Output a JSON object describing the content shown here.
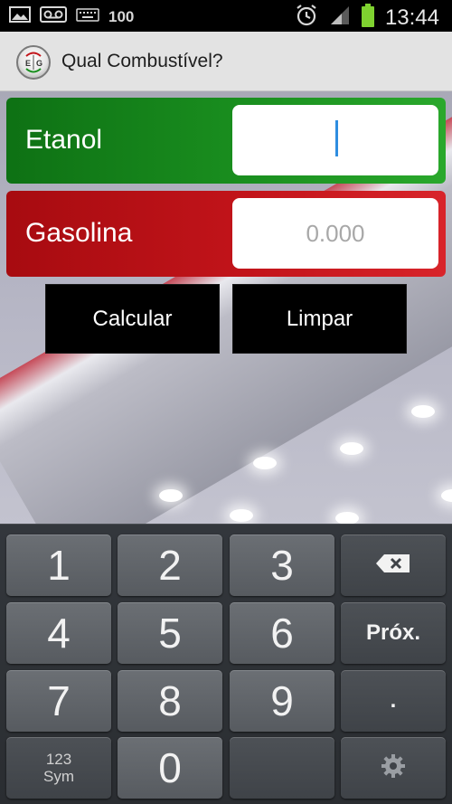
{
  "status_bar": {
    "notification_count": "100",
    "time": "13:44"
  },
  "app_bar": {
    "title": "Qual Combustível?",
    "logo_letters": "E G"
  },
  "form": {
    "etanol": {
      "label": "Etanol",
      "value": "",
      "placeholder": ""
    },
    "gasolina": {
      "label": "Gasolina",
      "value": "",
      "placeholder": "0.000"
    }
  },
  "buttons": {
    "calcular": "Calcular",
    "limpar": "Limpar"
  },
  "keyboard": {
    "rows": [
      [
        "1",
        "2",
        "3",
        "backspace"
      ],
      [
        "4",
        "5",
        "6",
        "Próx."
      ],
      [
        "7",
        "8",
        "9",
        "."
      ],
      [
        "123 Sym",
        "0",
        "",
        "settings"
      ]
    ],
    "key_1": "1",
    "key_2": "2",
    "key_3": "3",
    "key_4": "4",
    "key_5": "5",
    "key_6": "6",
    "key_7": "7",
    "key_8": "8",
    "key_9": "9",
    "key_0": "0",
    "next_label": "Próx.",
    "dot_label": ".",
    "sym_line1": "123",
    "sym_line2": "Sym"
  },
  "colors": {
    "etanol_accent": "#1a8f1f",
    "gasolina_accent": "#c2141a",
    "cursor": "#2e8de0"
  }
}
